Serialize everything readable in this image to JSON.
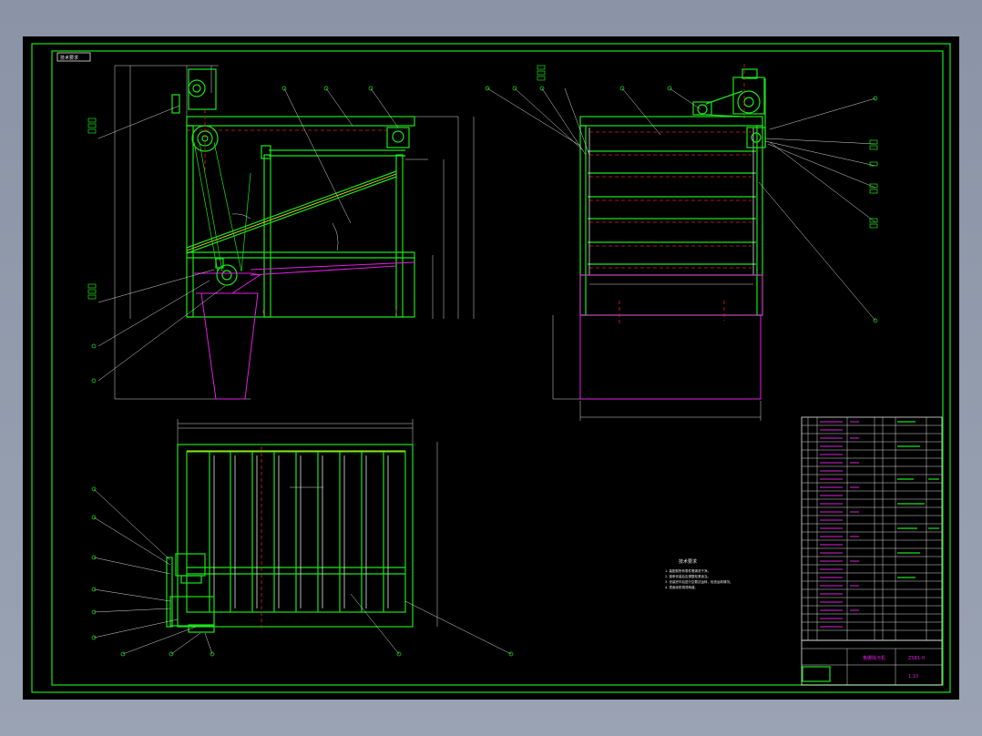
{
  "drawing": {
    "tag_label": "技术要求",
    "title_block": {
      "drawing_name": "格栅除污机",
      "drawing_number": "ZSB1-0",
      "scale": "1:10"
    },
    "notes_title": "技术要求",
    "notes": [
      "1. 装配前所有零件需清洗干净。",
      "2. 链条安装后应调整松紧适当。",
      "3. 安装完毕后进行空载试运转，检查运转情况。",
      "4. 表面涂防锈漆两道。"
    ]
  },
  "colors": {
    "background": "#000000",
    "frame": "#19e619",
    "dimension": "#e8e8e8",
    "hidden": "#e020e0",
    "centerline": "#e02020",
    "viewer_bg": "#8e98aa"
  }
}
